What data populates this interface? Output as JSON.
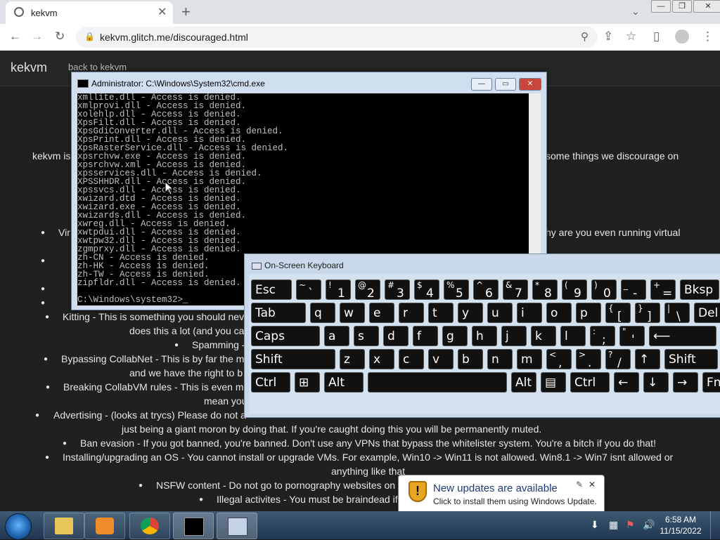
{
  "browser": {
    "tab_title": "kekvm",
    "tab_close": "✕",
    "new_tab": "+",
    "tab_dropdown": "⌄",
    "window_buttons": {
      "minimize": "—",
      "restore": "❐",
      "close": "✕"
    },
    "url": "kekvm.glitch.me/discouraged.html",
    "icons": [
      "back-arrow",
      "forward-arrow",
      "reload",
      "lock",
      "search",
      "share",
      "bookmark-star",
      "side-panel",
      "profile",
      "menu"
    ]
  },
  "page": {
    "brand": "kekvm",
    "back_link": "back to kekvm",
    "intro_left": "kekvm is",
    "intro_right": "some things we discourage on",
    "bullets": [
      {
        "left": "Vir",
        "right": "hy are you even running virtual"
      },
      {
        "text": "Kitting - This is something you should nev",
        "cont": "does this a lot (and you ca"
      },
      {
        "text": "Spamming -"
      },
      {
        "text": "Bypassing CollabNet - This is by far the m",
        "cont": "and we have the right to b"
      },
      {
        "text": "Breaking CollabVM rules - This is even m",
        "cont": "mean you"
      },
      {
        "text": "Advertising - (looks at trycs) Please do not a",
        "cont": "just being a giant moron by doing that. If you're caught doing this you will be permanently muted."
      },
      {
        "text": "Ban evasion - If you got banned, you're banned. Don't use any VPNs that bypass the whitelister system. You're a bitch if you do that!"
      },
      {
        "text": "Installing/upgrading an OS - You cannot install or upgrade VMs. For example, Win10 -> Win11 is not allowed. Win8.1 -> Win7 isnt allowed or",
        "cont": "anything like that"
      },
      {
        "text": "NSFW content - Do not go to pornography websites on"
      },
      {
        "text": "Illegal activites - You must be braindead if y"
      }
    ]
  },
  "cmd": {
    "title": "Administrator:  C:\\Windows\\System32\\cmd.exe",
    "buttons": {
      "minimize": "—",
      "maximize": "▭",
      "close": "✕"
    },
    "lines": [
      "xmllite.dll - Access is denied.",
      "xmlprovi.dll - Access is denied.",
      "xolehlp.dll - Access is denied.",
      "XpsFilt.dll - Access is denied.",
      "XpsGdiConverter.dll - Access is denied.",
      "XpsPrint.dll - Access is denied.",
      "XpsRasterService.dll - Access is denied.",
      "xpsrchvw.exe - Access is denied.",
      "xpsrchvw.xml - Access is denied.",
      "xpsservices.dll - Access is denied.",
      "XPSSHHDR.dll - Access is denied.",
      "xpssvcs.dll - Access is denied.",
      "xwizard.dtd - Access is denied.",
      "xwizard.exe - Access is denied.",
      "xwizards.dll - Access is denied.",
      "xwreg.dll - Access is denied.",
      "xwtpdui.dll - Access is denied.",
      "xwtpw32.dll - Access is denied.",
      "zgmprxy.dll - Access is denied.",
      "zh-CN - Access is denied.",
      "zh-HK - Access is denied.",
      "zh-TW - Access is denied.",
      "zipfldr.dll - Access is denied.",
      "",
      "C:\\Windows\\system32>_"
    ]
  },
  "osk": {
    "title": "On-Screen Keyboard",
    "rows": [
      [
        {
          "m": "Esc",
          "w": 60
        },
        {
          "s": "~",
          "b": "`",
          "w": 38
        },
        {
          "s": "!",
          "b": "1",
          "w": 38
        },
        {
          "s": "@",
          "b": "2",
          "w": 38
        },
        {
          "s": "#",
          "b": "3",
          "w": 38
        },
        {
          "s": "$",
          "b": "4",
          "w": 38
        },
        {
          "s": "%",
          "b": "5",
          "w": 38
        },
        {
          "s": "^",
          "b": "6",
          "w": 38
        },
        {
          "s": "&",
          "b": "7",
          "w": 38
        },
        {
          "s": "*",
          "b": "8",
          "w": 38
        },
        {
          "s": "(",
          "b": "9",
          "w": 38
        },
        {
          "s": ")",
          "b": "0",
          "w": 38
        },
        {
          "s": "_",
          "b": "-",
          "w": 38
        },
        {
          "s": "+",
          "b": "=",
          "w": 38
        },
        {
          "m": "Bksp",
          "w": 58
        }
      ],
      [
        {
          "m": "Tab",
          "w": 80
        },
        {
          "m": "q",
          "w": 38
        },
        {
          "m": "w",
          "w": 38
        },
        {
          "m": "e",
          "w": 38
        },
        {
          "m": "r",
          "w": 38
        },
        {
          "m": "t",
          "w": 38
        },
        {
          "m": "y",
          "w": 38
        },
        {
          "m": "u",
          "w": 38
        },
        {
          "m": "i",
          "w": 38
        },
        {
          "m": "o",
          "w": 38
        },
        {
          "m": "p",
          "w": 38
        },
        {
          "s": "{",
          "b": "[",
          "w": 38
        },
        {
          "s": "}",
          "b": "]",
          "w": 38
        },
        {
          "s": "|",
          "b": "\\",
          "w": 38
        },
        {
          "m": "Del",
          "w": 58
        }
      ],
      [
        {
          "m": "Caps",
          "w": 100
        },
        {
          "m": "a",
          "w": 38
        },
        {
          "m": "s",
          "w": 38
        },
        {
          "m": "d",
          "w": 38
        },
        {
          "m": "f",
          "w": 38
        },
        {
          "m": "g",
          "w": 38
        },
        {
          "m": "h",
          "w": 38
        },
        {
          "m": "j",
          "w": 38
        },
        {
          "m": "k",
          "w": 38
        },
        {
          "m": "l",
          "w": 38
        },
        {
          "s": ":",
          "b": ";",
          "w": 38
        },
        {
          "s": "\"",
          "b": "'",
          "w": 38
        },
        {
          "m": "⟵",
          "w": 98
        }
      ],
      [
        {
          "m": "Shift",
          "w": 122
        },
        {
          "m": "z",
          "w": 38
        },
        {
          "m": "x",
          "w": 38
        },
        {
          "m": "c",
          "w": 38
        },
        {
          "m": "v",
          "w": 38
        },
        {
          "m": "b",
          "w": 38
        },
        {
          "m": "n",
          "w": 38
        },
        {
          "m": "m",
          "w": 38
        },
        {
          "s": "<",
          "b": ",",
          "w": 38
        },
        {
          "s": ">",
          "b": ".",
          "w": 38
        },
        {
          "s": "?",
          "b": "/",
          "w": 38
        },
        {
          "m": "↑",
          "w": 38
        },
        {
          "m": "Shift",
          "w": 78
        }
      ],
      [
        {
          "m": "Ctrl",
          "w": 58
        },
        {
          "m": "⊞",
          "w": 38
        },
        {
          "m": "Alt",
          "w": 58
        },
        {
          "m": "",
          "w": 200
        },
        {
          "m": "Alt",
          "w": 38
        },
        {
          "m": "▤",
          "w": 38
        },
        {
          "m": "Ctrl",
          "w": 58
        },
        {
          "m": "←",
          "w": 38
        },
        {
          "m": "↓",
          "w": 38
        },
        {
          "m": "→",
          "w": 38
        },
        {
          "m": "Fn",
          "w": 38
        }
      ]
    ]
  },
  "notification": {
    "title": "New updates are available",
    "body": "Click to install them using Windows Update.",
    "close": "✕"
  },
  "taskbar": {
    "apps": [
      "explorer",
      "media-player",
      "chrome",
      "cmd",
      "on-screen-keyboard"
    ],
    "time": "6:58 AM",
    "date": "11/15/2022"
  }
}
